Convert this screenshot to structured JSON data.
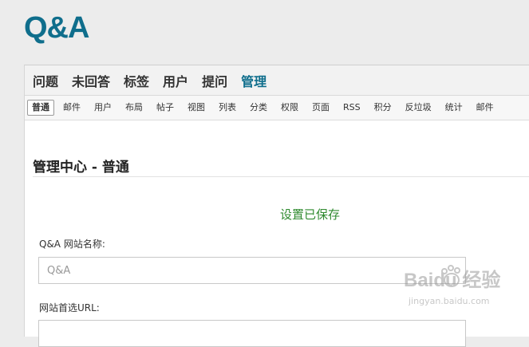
{
  "site": {
    "logo": "Q&A"
  },
  "main_nav": {
    "items": [
      {
        "label": "问题"
      },
      {
        "label": "未回答"
      },
      {
        "label": "标签"
      },
      {
        "label": "用户"
      },
      {
        "label": "提问"
      },
      {
        "label": "管理",
        "active": true
      }
    ]
  },
  "sub_nav": {
    "items": [
      {
        "label": "普通",
        "active": true
      },
      {
        "label": "邮件"
      },
      {
        "label": "用户"
      },
      {
        "label": "布局"
      },
      {
        "label": "帖子"
      },
      {
        "label": "视图"
      },
      {
        "label": "列表"
      },
      {
        "label": "分类"
      },
      {
        "label": "权限"
      },
      {
        "label": "页面"
      },
      {
        "label": "RSS"
      },
      {
        "label": "积分"
      },
      {
        "label": "反垃圾"
      },
      {
        "label": "统计"
      },
      {
        "label": "邮件"
      }
    ]
  },
  "page": {
    "title": "管理中心 - 普通",
    "save_message": "设置已保存"
  },
  "form": {
    "site_name_label": "Q&A 网站名称:",
    "site_name_value": "Q&A",
    "site_url_label": "网站首选URL:",
    "site_url_value": ""
  },
  "watermark": {
    "brand": "Baidu 经验",
    "url": "jingyan.baidu.com"
  },
  "colors": {
    "brand": "#0f6e8c",
    "success": "#2f8a2f",
    "background": "#ececec"
  }
}
